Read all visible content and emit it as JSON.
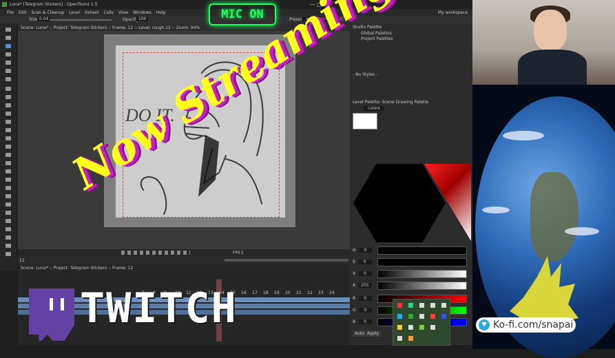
{
  "app": {
    "title": "Luna* [Telegram Stickers] : OpenToonz 1.5",
    "menu": [
      "File",
      "Edit",
      "Scan & Cleanup",
      "Level",
      "Xsheet",
      "Cells",
      "View",
      "Windows",
      "Help"
    ],
    "room": "My workspace"
  },
  "tool_options": {
    "size_label": "Size",
    "size_value": "0.04",
    "opacity_label": "Opacity",
    "opacity_value": "100",
    "preset_label": "Preset:",
    "preset_value": "<custom>"
  },
  "viewer": {
    "breadcrumb": "Scene: Luna*  ::  Project: Telegram Stickers  ::  Frame: 12  ::  Level: rough.12  ::  Zoom: 94%",
    "fps_label": "FPS",
    "fps_value": "1"
  },
  "frame": {
    "value": "12"
  },
  "xsheet": {
    "breadcrumb": "Scene: Luna*  ::  Project: Telegram Stickers  ::  Frame: 12",
    "frame_numbers": [
      "7",
      "8",
      "9",
      "10",
      "11",
      "12",
      "13",
      "14",
      "15",
      "16",
      "17",
      "18",
      "19",
      "20",
      "21",
      "22",
      "23",
      "24"
    ]
  },
  "palettes": {
    "studio_title": "Studio Palette",
    "studio_items": [
      "Global Palettes",
      "Project Palettes"
    ],
    "styles_label": "- No Styles -",
    "level_palette_title": "Level Palette: Scene Drawing Palette",
    "palette_name": "colors"
  },
  "style_editor": {
    "channels": [
      {
        "label": "H",
        "value": "0"
      },
      {
        "label": "S",
        "value": "0"
      },
      {
        "label": "V",
        "value": "0"
      },
      {
        "label": "A",
        "value": "255"
      },
      {
        "label": "R",
        "value": "0"
      },
      {
        "label": "G",
        "value": "0"
      },
      {
        "label": "B",
        "value": "0"
      }
    ],
    "auto_label": "Auto",
    "apply_label": "Apply"
  },
  "overlay": {
    "mic_status": "MIC ON",
    "headline": "Now Streaming!",
    "brand": "TWITCH",
    "kofi": "Ko-fi.com/snapai",
    "sketch_text": "DO IT."
  },
  "colors": {
    "headline": "#ffff1c",
    "headline_shadow": "#c71ec7",
    "mic": "#1bff5a",
    "twitch": "#6441a5"
  }
}
